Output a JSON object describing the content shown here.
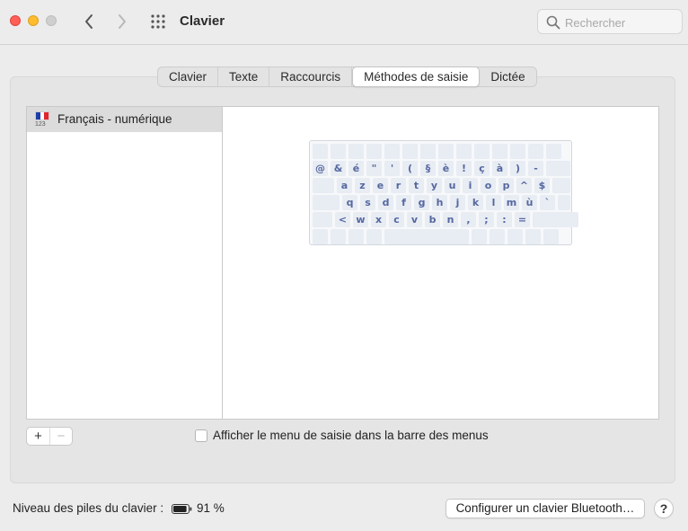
{
  "window": {
    "title": "Clavier",
    "search_placeholder": "Rechercher"
  },
  "tabs": [
    {
      "label": "Clavier",
      "active": false
    },
    {
      "label": "Texte",
      "active": false
    },
    {
      "label": "Raccourcis",
      "active": false
    },
    {
      "label": "Méthodes de saisie",
      "active": true
    },
    {
      "label": "Dictée",
      "active": false
    }
  ],
  "sources": {
    "items": [
      {
        "label": "Français - numérique",
        "flag_caption": "123",
        "selected": true
      }
    ]
  },
  "keyboard_rows": [
    [
      "",
      "",
      "",
      "",
      "",
      "",
      "",
      "",
      "",
      "",
      "",
      "",
      "",
      ""
    ],
    [
      "@",
      "&",
      "é",
      "\"",
      "'",
      "(",
      "§",
      "è",
      "!",
      "ç",
      "à",
      ")",
      "-",
      ""
    ],
    [
      "",
      "a",
      "z",
      "e",
      "r",
      "t",
      "y",
      "u",
      "i",
      "o",
      "p",
      "^",
      "$",
      ""
    ],
    [
      "",
      "q",
      "s",
      "d",
      "f",
      "g",
      "h",
      "j",
      "k",
      "l",
      "m",
      "ù",
      "`",
      ""
    ],
    [
      "",
      "<",
      "w",
      "x",
      "c",
      "v",
      "b",
      "n",
      ",",
      ";",
      ":",
      "=",
      ""
    ],
    [
      "",
      "",
      "",
      "",
      "",
      "",
      "",
      "",
      "",
      ""
    ]
  ],
  "controls": {
    "add_label": "+",
    "remove_label": "−",
    "show_menu_label": "Afficher le menu de saisie dans la barre des menus",
    "show_menu_checked": false
  },
  "footer": {
    "battery_label": "Niveau des piles du clavier :",
    "battery_percent": "91 %",
    "battery_level": 0.91,
    "bluetooth_button": "Configurer un clavier Bluetooth…",
    "help_label": "?"
  },
  "colors": {
    "close": "#fe5f57",
    "minimize": "#febc2e",
    "zoom_disabled": "#cfcfcf",
    "key_text": "#5568a0",
    "key_bg": "#e8ecf3"
  }
}
